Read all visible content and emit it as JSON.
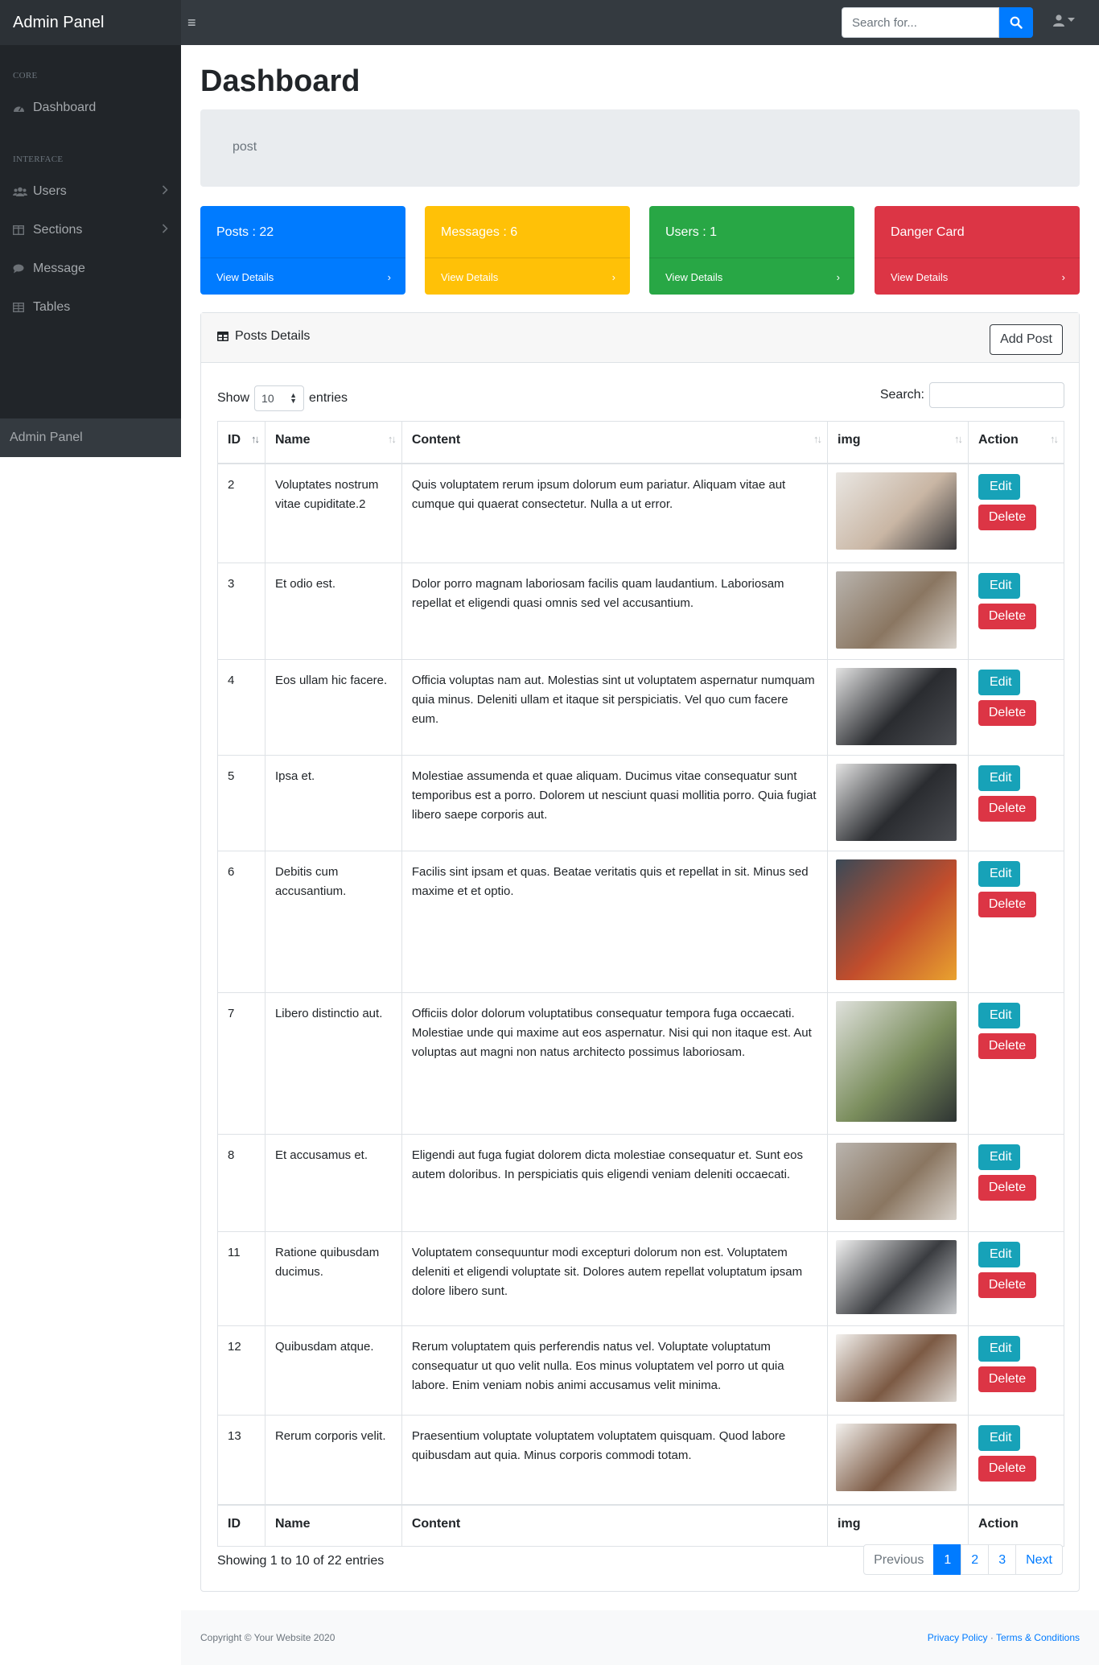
{
  "navbar": {
    "brand": "Admin Panel",
    "toggle_icon": "bars-icon",
    "search_placeholder": "Search for...",
    "search_icon": "search-icon",
    "user_icon": "user-icon"
  },
  "sidebar": {
    "heading_core": "Core",
    "heading_interface": "Interface",
    "items": [
      {
        "label": "Dashboard",
        "icon": "tachometer-icon"
      },
      {
        "label": "Users",
        "icon": "users-icon",
        "has_children": true
      },
      {
        "label": "Sections",
        "icon": "columns-icon",
        "has_children": true
      },
      {
        "label": "Message",
        "icon": "comment-icon"
      },
      {
        "label": "Tables",
        "icon": "table-icon"
      }
    ],
    "footer": "Admin Panel"
  },
  "page": {
    "title": "Dashboard",
    "breadcrumb": "post"
  },
  "cards": [
    {
      "title": "Posts : 22",
      "link": "View Details",
      "color": "#007bff"
    },
    {
      "title": "Messages : 6",
      "link": "View Details",
      "color": "#ffc107"
    },
    {
      "title": "Users : 1",
      "link": "View Details",
      "color": "#28a745"
    },
    {
      "title": "Danger Card",
      "link": "View Details",
      "color": "#dc3545"
    }
  ],
  "posts_table": {
    "card_title": "Posts Details",
    "add_button": "Add Post",
    "show_label": "Show",
    "entries_label": "entries",
    "page_length": "10",
    "search_label": "Search:",
    "columns": [
      "ID",
      "Name",
      "Content",
      "img",
      "Action"
    ],
    "edit_label": "Edit",
    "delete_label": "Delete",
    "rows": [
      {
        "id": "2",
        "name": "Voluptates nostrum vitae cupiditate.2",
        "content": "Quis voluptatem rerum ipsum dolorum eum pariatur. Aliquam vitae aut cumque qui quaerat consectetur. Nulla a ut error.",
        "img": "students-microscope"
      },
      {
        "id": "3",
        "name": "Et odio est.",
        "content": "Dolor porro magnam laboriosam facilis quam laudantium. Laboriosam repellat et eligendi quasi omnis sed vel accusantium.",
        "img": "paint-palette"
      },
      {
        "id": "4",
        "name": "Eos ullam hic facere.",
        "content": "Officia voluptas nam aut. Molestias sint ut voluptatem aspernatur numquam quia minus. Deleniti ullam et itaque sit perspiciatis. Vel quo cum facere eum.",
        "img": "classroom-presentation"
      },
      {
        "id": "5",
        "name": "Ipsa et.",
        "content": "Molestiae assumenda et quae aliquam. Ducimus vitae consequatur sunt temporibus est a porro. Dolorem ut nesciunt quasi mollitia porro. Quia fugiat libero saepe corporis aut.",
        "img": "classroom-presentation"
      },
      {
        "id": "6",
        "name": "Debitis cum accusantium.",
        "content": "Facilis sint ipsam et quas. Beatae veritatis quis et repellat in sit. Minus sed maxime et et optio.",
        "img": "paint-cups"
      },
      {
        "id": "7",
        "name": "Libero distinctio aut.",
        "content": "Officiis dolor dolorum voluptatibus consequatur tempora fuga occaecati. Molestiae unde qui maxime aut eos aspernatur. Nisi qui non itaque est. Aut voluptas aut magni non natus architecto possimus laboriosam.",
        "img": "pencil-cup-classroom"
      },
      {
        "id": "8",
        "name": "Et accusamus et.",
        "content": "Eligendi aut fuga fugiat dolorem dicta molestiae consequatur et. Sunt eos autem doloribus. In perspiciatis quis eligendi veniam deleniti occaecati.",
        "img": "paint-palette"
      },
      {
        "id": "11",
        "name": "Ratione quibusdam ducimus.",
        "content": "Voluptatem consequuntur modi excepturi dolorum non est. Voluptatem deleniti et eligendi voluptate sit. Dolores autem repellat voluptatum ipsam dolore libero sunt.",
        "img": "lecture-room"
      },
      {
        "id": "12",
        "name": "Quibusdam atque.",
        "content": "Rerum voluptatem quis perferendis natus vel. Voluptate voluptatum consequatur ut quo velit nulla. Eos minus voluptatem vel porro ut quia labore. Enim veniam nobis animi accusamus velit minima.",
        "img": "student-lab"
      },
      {
        "id": "13",
        "name": "Rerum corporis velit.",
        "content": "Praesentium voluptate voluptatem voluptatem quisquam. Quod labore quibusdam aut quia. Minus corporis commodi totam.",
        "img": "student-lab"
      }
    ],
    "info": "Showing 1 to 10 of 22 entries",
    "pagination": {
      "previous": "Previous",
      "pages": [
        "1",
        "2",
        "3"
      ],
      "current": "1",
      "next": "Next"
    }
  },
  "footer": {
    "copyright": "Copyright © Your Website 2020",
    "privacy": "Privacy Policy",
    "separator": "·",
    "terms": "Terms & Conditions"
  }
}
